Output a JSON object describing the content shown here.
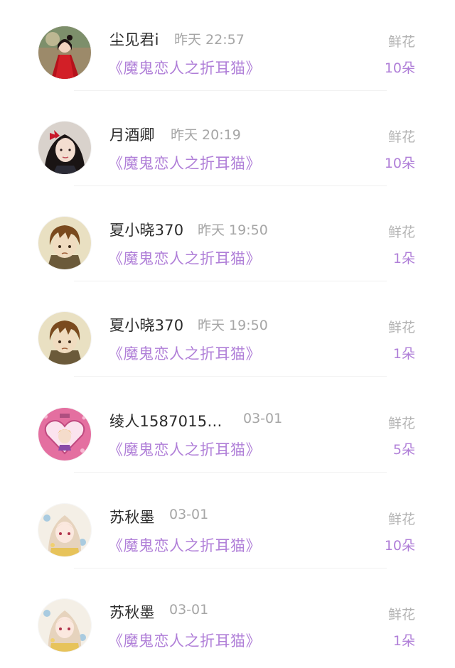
{
  "entries": [
    {
      "user": "尘见君i",
      "time": "昨天 22:57",
      "book": "《魔鬼恋人之折耳猫》",
      "gift_label": "鲜花",
      "gift_count": "10朵",
      "avatar_icon": "avatar-red-dress-girl"
    },
    {
      "user": "月酒卿",
      "time": "昨天 20:19",
      "book": "《魔鬼恋人之折耳猫》",
      "gift_label": "鲜花",
      "gift_count": "10朵",
      "avatar_icon": "avatar-girl-red-bow"
    },
    {
      "user": "夏小晓370",
      "time": "昨天 19:50",
      "book": "《魔鬼恋人之折耳猫》",
      "gift_label": "鲜花",
      "gift_count": "1朵",
      "avatar_icon": "avatar-brown-hair-boy"
    },
    {
      "user": "夏小晓370",
      "time": "昨天 19:50",
      "book": "《魔鬼恋人之折耳猫》",
      "gift_label": "鲜花",
      "gift_count": "1朵",
      "avatar_icon": "avatar-brown-hair-boy"
    },
    {
      "user": "绫人1587015…",
      "time": "03-01",
      "book": "《魔鬼恋人之折耳猫》",
      "gift_label": "鲜花",
      "gift_count": "5朵",
      "avatar_icon": "avatar-pink-heart-frame"
    },
    {
      "user": "苏秋墨",
      "time": "03-01",
      "book": "《魔鬼恋人之折耳猫》",
      "gift_label": "鲜花",
      "gift_count": "10朵",
      "avatar_icon": "avatar-anime-girl-light-hair"
    },
    {
      "user": "苏秋墨",
      "time": "03-01",
      "book": "《魔鬼恋人之折耳猫》",
      "gift_label": "鲜花",
      "gift_count": "1朵",
      "avatar_icon": "avatar-anime-girl-light-hair"
    }
  ],
  "colors": {
    "book_title": "#b07fd8",
    "gift_count": "#b07fd8",
    "gift_label": "#b3b3b3",
    "time": "#a6a6a6",
    "name": "#2b2b2b"
  }
}
